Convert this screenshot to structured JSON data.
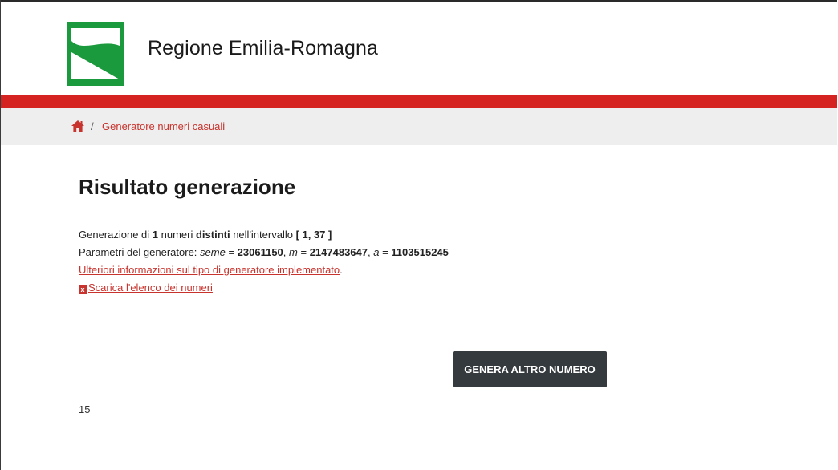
{
  "header": {
    "site_title": "Regione Emilia-Romagna",
    "brand_green": "#1a9a3d",
    "accent_red": "#d42320"
  },
  "breadcrumb": {
    "home_icon": "home-icon",
    "separator": "/",
    "current": "Generatore numeri casuali"
  },
  "main": {
    "title": "Risultato generazione",
    "line1": {
      "prefix": "Generazione di ",
      "count": "1",
      "mid1": " numeri ",
      "kind": "distinti",
      "mid2": " nell'intervallo ",
      "range": "[ 1, 37 ]"
    },
    "line2": {
      "prefix": "Parametri del generatore: ",
      "seed_label": "seme",
      "eq1": " = ",
      "seed_value": "23061150",
      "sep1": ", ",
      "m_label": "m",
      "eq2": " = ",
      "m_value": "2147483647",
      "sep2": ", ",
      "a_label": "a",
      "eq3": " = ",
      "a_value": "1103515245"
    },
    "info_link": "Ulteriori informazioni sul tipo di generatore implementato",
    "info_link_suffix": ".",
    "download_icon": "excel-icon",
    "download_icon_glyph": "x",
    "download_link": "Scarica l'elenco dei numeri",
    "generate_button": "GENERA ALTRO NUMERO",
    "result_value": "15"
  }
}
